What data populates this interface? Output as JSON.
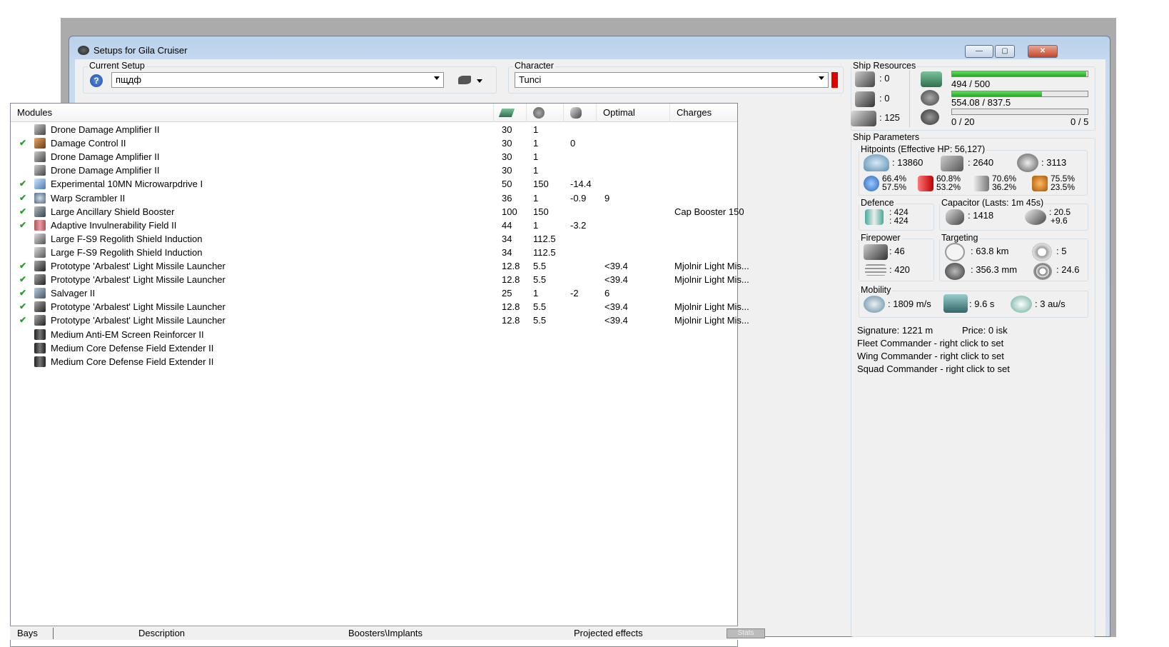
{
  "window": {
    "title": "Setups for Gila Cruiser"
  },
  "setup": {
    "label": "Current Setup",
    "value": "пщдф"
  },
  "character": {
    "label": "Character",
    "value": "Tunci",
    "indicator_color": "#e00000"
  },
  "modules": {
    "columns": [
      "Modules",
      "",
      "",
      "",
      "Optimal",
      "Charges"
    ],
    "column_icons": [
      "cpu-icon",
      "powergrid-icon",
      "capacitor-icon"
    ],
    "rows": [
      {
        "name": "Drone Damage Amplifier II",
        "active": false,
        "cpu": "30",
        "pg": "1",
        "cap": "",
        "optimal": "",
        "charges": "",
        "icon": "drone-amp-icon"
      },
      {
        "name": "Damage Control II",
        "active": true,
        "cpu": "30",
        "pg": "1",
        "cap": "0",
        "optimal": "",
        "charges": "",
        "icon": "damage-control-icon"
      },
      {
        "name": "Drone Damage Amplifier II",
        "active": false,
        "cpu": "30",
        "pg": "1",
        "cap": "",
        "optimal": "",
        "charges": "",
        "icon": "drone-amp-icon"
      },
      {
        "name": "Drone Damage Amplifier II",
        "active": false,
        "cpu": "30",
        "pg": "1",
        "cap": "",
        "optimal": "",
        "charges": "",
        "icon": "drone-amp-icon"
      },
      {
        "name": "Experimental 10MN Microwarpdrive I",
        "active": true,
        "cpu": "50",
        "pg": "150",
        "cap": "-14.4",
        "optimal": "",
        "charges": "",
        "icon": "mwd-icon"
      },
      {
        "name": "Warp Scrambler II",
        "active": true,
        "cpu": "36",
        "pg": "1",
        "cap": "-0.9",
        "optimal": "9",
        "charges": "",
        "icon": "scrambler-icon"
      },
      {
        "name": "Large Ancillary Shield Booster",
        "active": true,
        "cpu": "100",
        "pg": "150",
        "cap": "",
        "optimal": "",
        "charges": "Cap Booster 150",
        "icon": "shield-booster-icon"
      },
      {
        "name": "Adaptive Invulnerability Field II",
        "active": true,
        "cpu": "44",
        "pg": "1",
        "cap": "-3.2",
        "optimal": "",
        "charges": "",
        "icon": "invuln-icon"
      },
      {
        "name": "Large F-S9 Regolith Shield Induction",
        "active": false,
        "cpu": "34",
        "pg": "112.5",
        "cap": "",
        "optimal": "",
        "charges": "",
        "icon": "shield-extender-icon"
      },
      {
        "name": "Large F-S9 Regolith Shield Induction",
        "active": false,
        "cpu": "34",
        "pg": "112.5",
        "cap": "",
        "optimal": "",
        "charges": "",
        "icon": "shield-extender-icon"
      },
      {
        "name": "Prototype 'Arbalest' Light Missile Launcher",
        "active": true,
        "cpu": "12.8",
        "pg": "5.5",
        "cap": "",
        "optimal": "<39.4",
        "charges": "Mjolnir Light Mis...",
        "icon": "launcher-icon"
      },
      {
        "name": "Prototype 'Arbalest' Light Missile Launcher",
        "active": true,
        "cpu": "12.8",
        "pg": "5.5",
        "cap": "",
        "optimal": "<39.4",
        "charges": "Mjolnir Light Mis...",
        "icon": "launcher-icon"
      },
      {
        "name": "Salvager II",
        "active": true,
        "cpu": "25",
        "pg": "1",
        "cap": "-2",
        "optimal": "6",
        "charges": "",
        "icon": "salvager-icon"
      },
      {
        "name": "Prototype 'Arbalest' Light Missile Launcher",
        "active": true,
        "cpu": "12.8",
        "pg": "5.5",
        "cap": "",
        "optimal": "<39.4",
        "charges": "Mjolnir Light Mis...",
        "icon": "launcher-icon"
      },
      {
        "name": "Prototype 'Arbalest' Light Missile Launcher",
        "active": true,
        "cpu": "12.8",
        "pg": "5.5",
        "cap": "",
        "optimal": "<39.4",
        "charges": "Mjolnir Light Mis...",
        "icon": "launcher-icon"
      },
      {
        "name": "Medium Anti-EM Screen Reinforcer II",
        "active": false,
        "cpu": "",
        "pg": "",
        "cap": "",
        "optimal": "",
        "charges": "",
        "icon": "rig-icon"
      },
      {
        "name": "Medium Core Defense Field Extender II",
        "active": false,
        "cpu": "",
        "pg": "",
        "cap": "",
        "optimal": "",
        "charges": "",
        "icon": "rig-icon"
      },
      {
        "name": "Medium Core Defense Field Extender II",
        "active": false,
        "cpu": "",
        "pg": "",
        "cap": "",
        "optimal": "",
        "charges": "",
        "icon": "rig-icon"
      }
    ]
  },
  "tabs": [
    "Bays",
    "Description",
    "Boosters\\Implants",
    "Projected effects",
    "Stats"
  ],
  "resources": {
    "label": "Ship Resources",
    "turret": ": 0",
    "launcher": ": 0",
    "calibration": ": 125",
    "cpu": "494 / 500",
    "cpu_fraction": 0.988,
    "powergrid": "554.08 / 837.5",
    "pg_fraction": 0.662,
    "drone_bw": "0 / 20",
    "drones": "0 / 5",
    "drone_fraction": 0
  },
  "params": {
    "label": "Ship Parameters",
    "hitpoints_label": "Hitpoints (Effective HP: 56,127)",
    "shield_hp": ": 13860",
    "armor_hp": ": 2640",
    "hull_hp": ": 3113",
    "res1a": "66.4%",
    "res1b": "57.5%",
    "res2a": "60.8%",
    "res2b": "53.2%",
    "res3a": "70.6%",
    "res3b": "36.2%",
    "res4a": "75.5%",
    "res4b": "23.5%",
    "defence_label": "Defence",
    "def1": ": 424",
    "def2": ": 424",
    "capacitor_label": "Capacitor (Lasts: 1m 45s)",
    "cap_amount": ": 1418",
    "cap_delta1": ": 20.5",
    "cap_delta2": "+9.6",
    "firepower_label": "Firepower",
    "volley": ": 46",
    "dps": ": 420",
    "targeting_label": "Targeting",
    "range": ": 63.8 km",
    "max_targets": ": 5",
    "scan_res": ": 356.3 mm",
    "sensor": ": 24.6",
    "mobility_label": "Mobility",
    "speed": ": 1809 m/s",
    "align": ": 9.6 s",
    "warp": ": 3 au/s",
    "signature": "Signature: 1221 m",
    "price": "Price: 0 isk",
    "fleet": "Fleet Commander - right click to set",
    "wing": "Wing Commander - right click to set",
    "squad": "Squad Commander - right click to set"
  }
}
